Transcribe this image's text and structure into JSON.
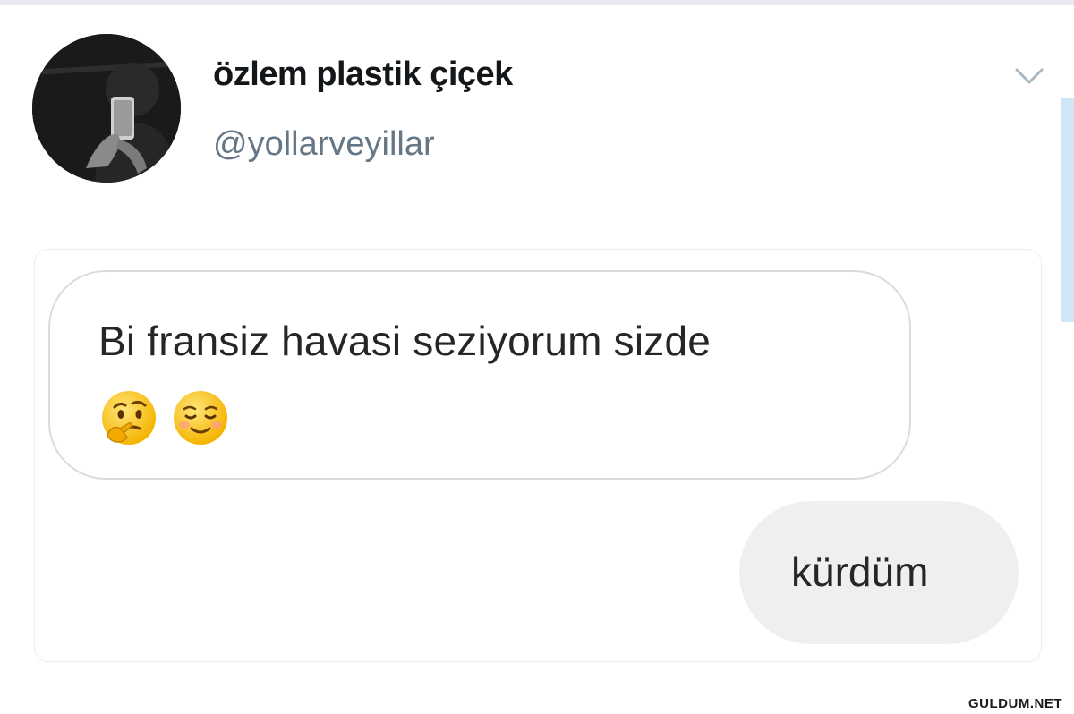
{
  "tweet": {
    "display_name": "özlem plastik çiçek",
    "handle": "@yollarveyillar"
  },
  "messages": [
    {
      "direction": "incoming",
      "text": "Bi fransiz havasi seziyorum sizde",
      "emojis": [
        "thinking-face-emoji",
        "smiling-face-emoji"
      ]
    },
    {
      "direction": "outgoing",
      "text": "kürdüm"
    }
  ],
  "icons": {
    "caret": "chevron-down-icon"
  },
  "colors": {
    "name": "#14171a",
    "handle": "#657786",
    "outgoing_bubble": "#efefef",
    "incoming_border": "#d9dbdf"
  },
  "watermark": "GULDUM.NET"
}
